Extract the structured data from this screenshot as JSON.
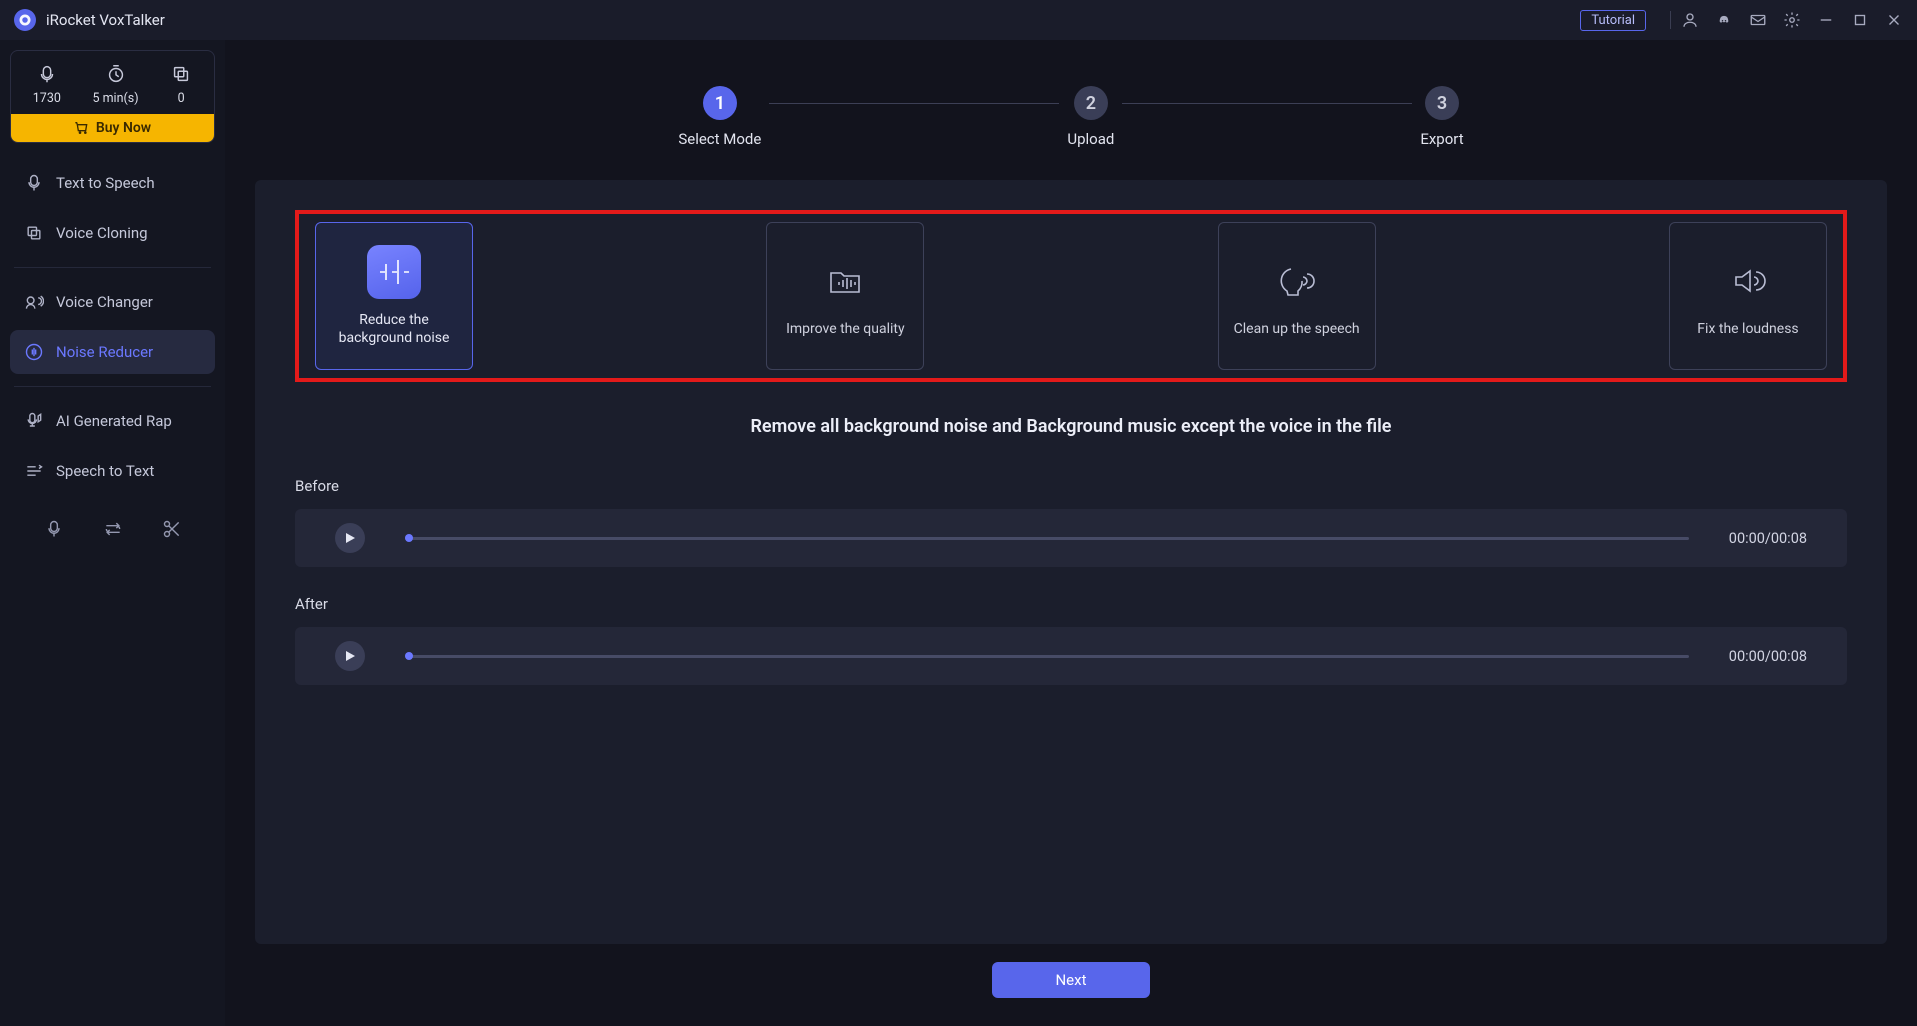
{
  "app": {
    "title": "iRocket VoxTalker",
    "tutorial": "Tutorial"
  },
  "credits": {
    "count": "1730",
    "duration": "5 min(s)",
    "other": "0",
    "buy": "Buy Now"
  },
  "sidebar": {
    "items": [
      {
        "label": "Text to Speech"
      },
      {
        "label": "Voice Cloning"
      },
      {
        "label": "Voice Changer"
      },
      {
        "label": "Noise Reducer"
      },
      {
        "label": "AI Generated Rap"
      },
      {
        "label": "Speech to Text"
      }
    ]
  },
  "steps": [
    {
      "num": "1",
      "label": "Select Mode"
    },
    {
      "num": "2",
      "label": "Upload"
    },
    {
      "num": "3",
      "label": "Export"
    }
  ],
  "modes": [
    {
      "label": "Reduce the background noise"
    },
    {
      "label": "Improve the quality"
    },
    {
      "label": "Clean up the speech"
    },
    {
      "label": "Fix the loudness"
    }
  ],
  "description": "Remove all background noise and Background music except the voice in the file",
  "players": {
    "before": {
      "label": "Before",
      "time": "00:00/00:08"
    },
    "after": {
      "label": "After",
      "time": "00:00/00:08"
    }
  },
  "next": "Next"
}
